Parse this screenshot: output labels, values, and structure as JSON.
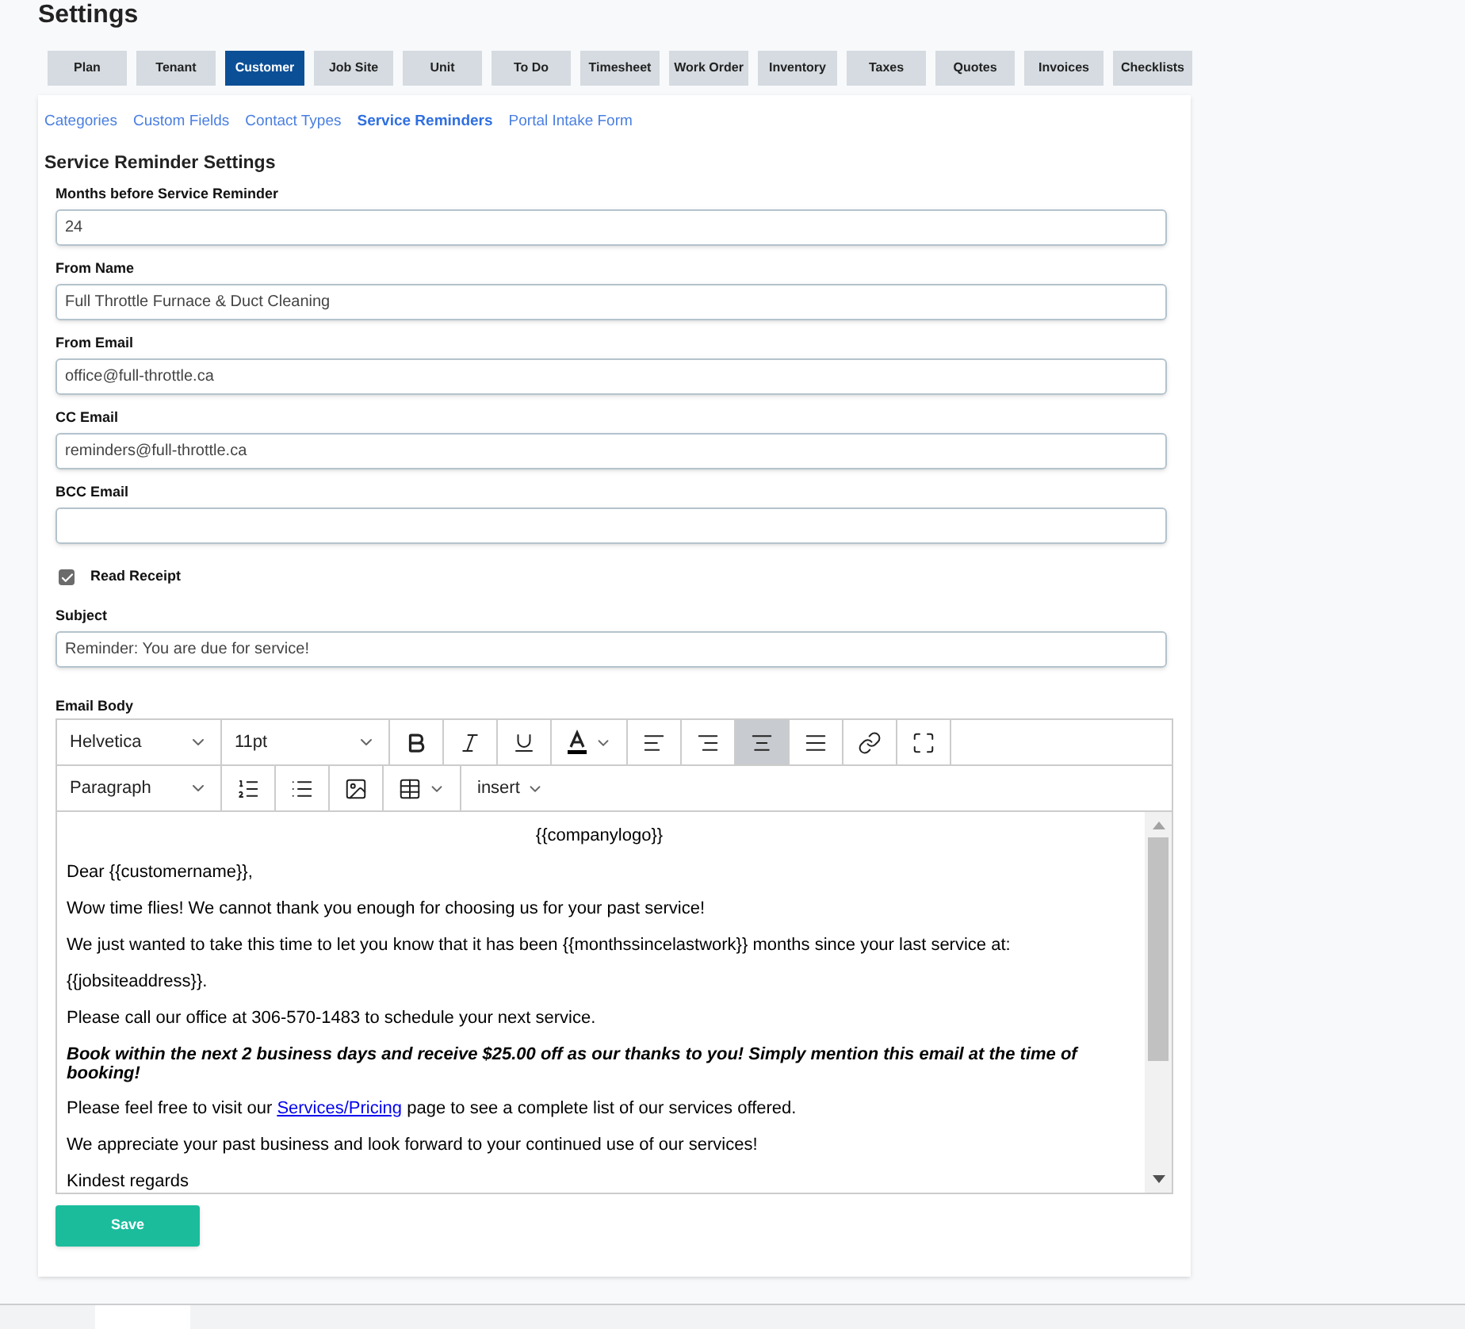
{
  "page_title": "Settings",
  "tabs": [
    {
      "label": "Plan",
      "selected": false
    },
    {
      "label": "Tenant",
      "selected": false
    },
    {
      "label": "Customer",
      "selected": true
    },
    {
      "label": "Job Site",
      "selected": false
    },
    {
      "label": "Unit",
      "selected": false
    },
    {
      "label": "To Do",
      "selected": false
    },
    {
      "label": "Timesheet",
      "selected": false
    },
    {
      "label": "Work Order",
      "selected": false
    },
    {
      "label": "Inventory",
      "selected": false
    },
    {
      "label": "Taxes",
      "selected": false
    },
    {
      "label": "Quotes",
      "selected": false
    },
    {
      "label": "Invoices",
      "selected": false
    },
    {
      "label": "Checklists",
      "selected": false
    }
  ],
  "subnav": [
    {
      "label": "Categories",
      "selected": false
    },
    {
      "label": "Custom Fields",
      "selected": false
    },
    {
      "label": "Contact Types",
      "selected": false
    },
    {
      "label": "Service Reminders",
      "selected": true
    },
    {
      "label": "Portal Intake Form",
      "selected": false
    }
  ],
  "section_title": "Service Reminder Settings",
  "fields": [
    {
      "kind": "input",
      "label": "Months before Service Reminder",
      "value": "24"
    },
    {
      "kind": "input",
      "label": "From Name",
      "value": "Full Throttle Furnace & Duct Cleaning"
    },
    {
      "kind": "input",
      "label": "From Email",
      "value": "office@full-throttle.ca"
    },
    {
      "kind": "input",
      "label": "CC Email",
      "value": "reminders@full-throttle.ca"
    },
    {
      "kind": "input",
      "label": "BCC Email"
    },
    {
      "kind": "checkbox",
      "label": "Read Receipt",
      "checked": true
    },
    {
      "kind": "input",
      "label": "Subject",
      "value": "Reminder: You are due for service!"
    }
  ],
  "editor": {
    "label": "Email Body",
    "font_family": "Helvetica",
    "font_size": "11pt",
    "block_format": "Paragraph",
    "insert_menu": "insert",
    "toolbar": [
      {
        "kind": "bold",
        "active": false
      },
      {
        "kind": "italic",
        "active": false
      },
      {
        "kind": "underline",
        "active": false
      },
      {
        "kind": "color",
        "active": false
      },
      {
        "kind": "align-left",
        "active": false
      },
      {
        "kind": "align-right",
        "active": false
      },
      {
        "kind": "align-center",
        "active": true
      },
      {
        "kind": "justify",
        "active": false
      },
      {
        "kind": "link",
        "active": false
      },
      {
        "kind": "fullscreen",
        "active": false
      }
    ],
    "toolbar_2": [
      {
        "kind": "ordered-list"
      },
      {
        "kind": "bullet-list"
      },
      {
        "kind": "image"
      },
      {
        "kind": "table"
      }
    ],
    "body": [
      {
        "kind": "center",
        "text": "{{companylogo}}"
      },
      {
        "kind": "plain",
        "text": "Dear {{customername}},"
      },
      {
        "kind": "plain",
        "text": "Wow time flies! We cannot thank you enough for choosing us for your past service!"
      },
      {
        "kind": "plain",
        "text": "We just wanted to take this time to let you know that it has been {{monthssincelastwork}} months since your last service at:"
      },
      {
        "kind": "plain",
        "text": "{{jobsiteaddress}}."
      },
      {
        "kind": "plain",
        "text": "Please call our office at 306-570-1483 to schedule your next service."
      },
      {
        "kind": "emphasis",
        "text": "Book within the next 2 business days and receive $25.00 off as our thanks to you! Simply mention this email at the time of booking!"
      },
      {
        "kind": "link",
        "before": "Please feel free to visit our ",
        "link": "Services/Pricing",
        "after": " page to see a complete list of our services offered."
      },
      {
        "kind": "plain",
        "text": "We appreciate your past business and look forward to your continued use of our services!"
      },
      {
        "kind": "plain",
        "text": "Kindest regards"
      }
    ]
  },
  "save_button": "Save"
}
